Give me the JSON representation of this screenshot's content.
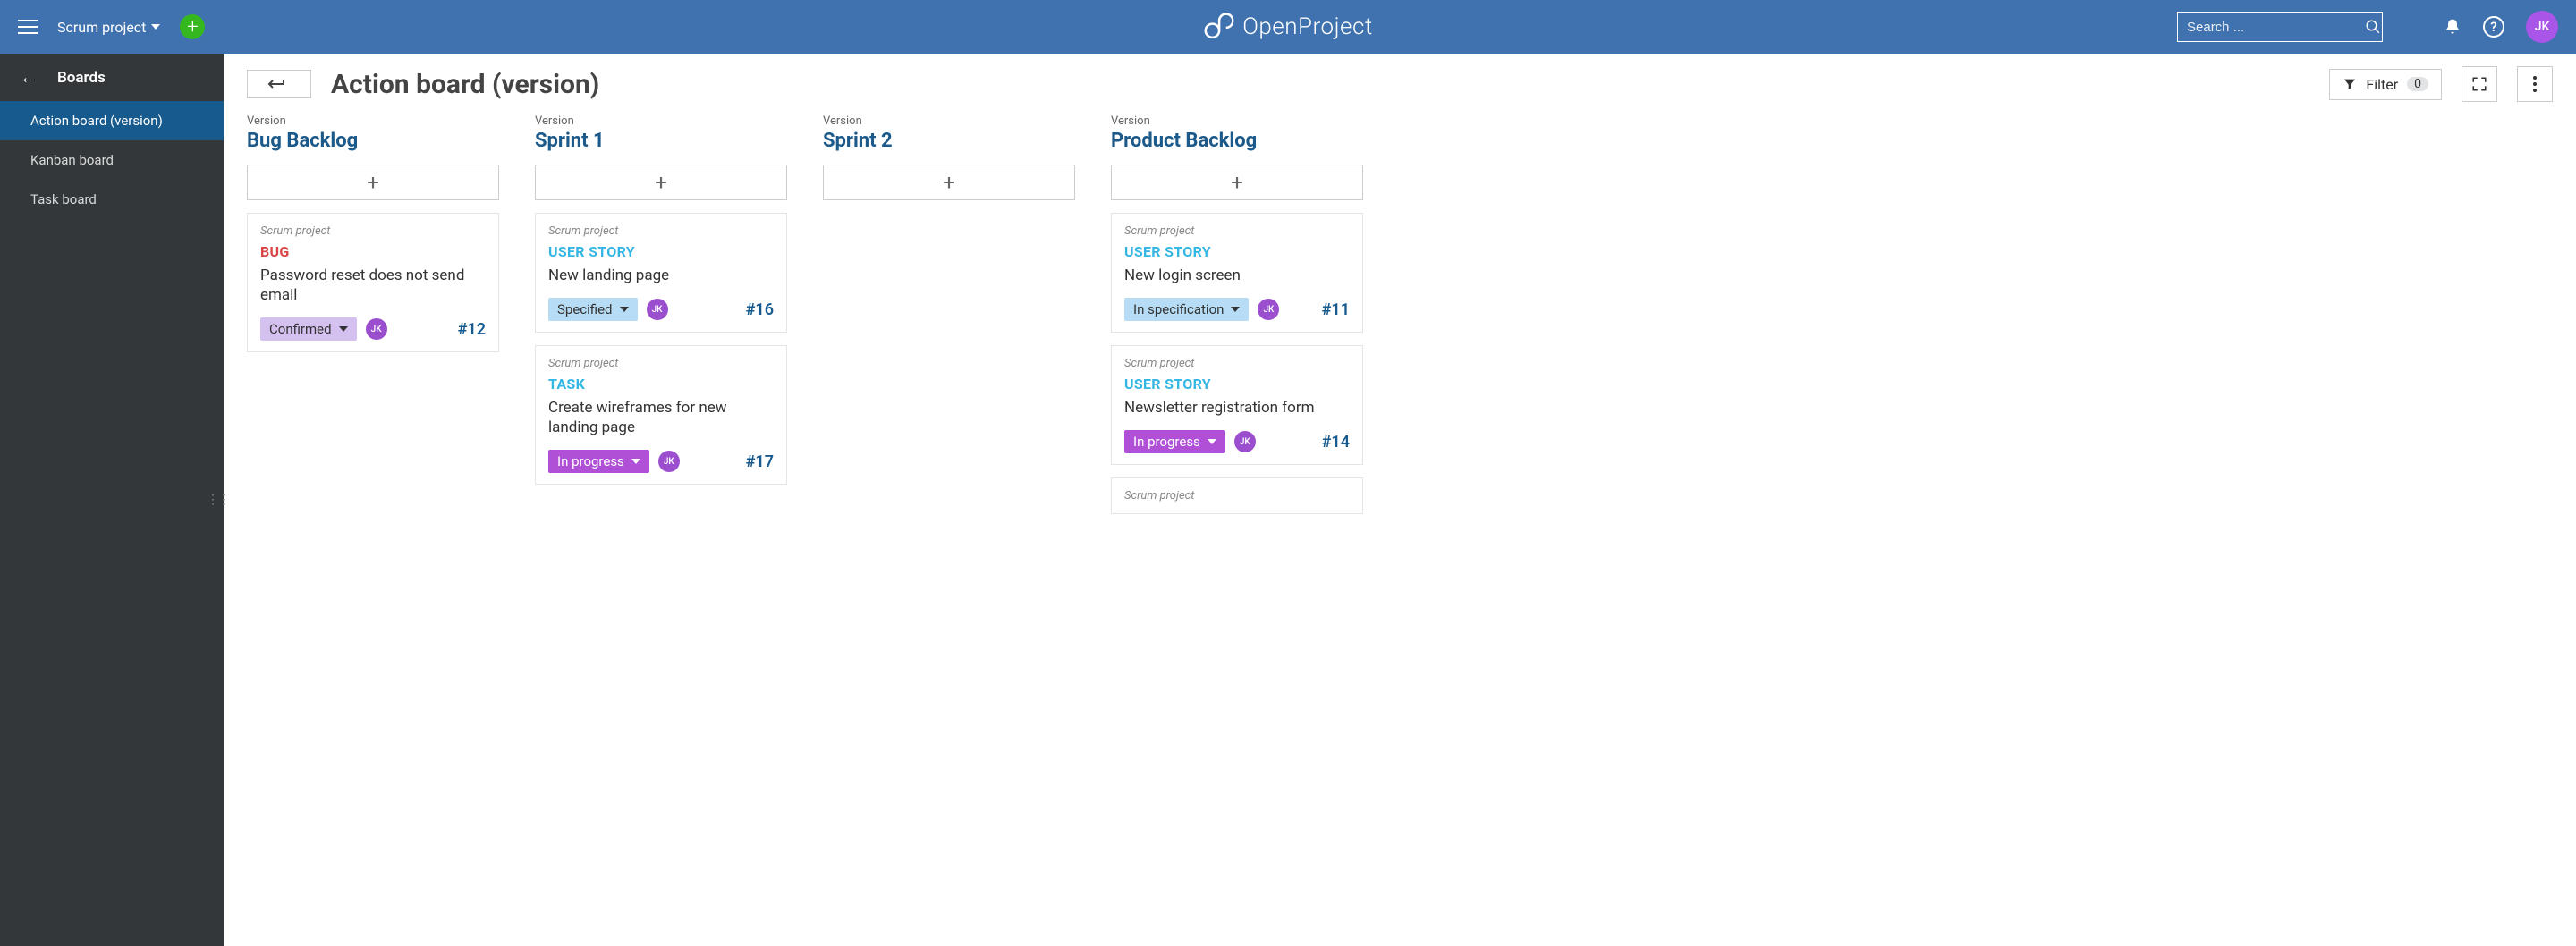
{
  "header": {
    "project_name": "Scrum project",
    "logo_text": "OpenProject",
    "search_placeholder": "Search ...",
    "user_initials": "JK"
  },
  "sidebar": {
    "section_title": "Boards",
    "items": [
      {
        "label": "Action board (version)",
        "active": true
      },
      {
        "label": "Kanban board",
        "active": false
      },
      {
        "label": "Task board",
        "active": false
      }
    ]
  },
  "toolbar": {
    "page_title": "Action board (version)",
    "filter_label": "Filter",
    "filter_count": "0"
  },
  "board": {
    "column_label": "Version",
    "columns": [
      {
        "title": "Bug Backlog",
        "cards": [
          {
            "project": "Scrum project",
            "type": "BUG",
            "type_class": "type-bug",
            "title": "Password reset does not send email",
            "status": "Confirmed",
            "status_class": "status-confirmed",
            "assignee": "JK",
            "id": "#12"
          }
        ]
      },
      {
        "title": "Sprint 1",
        "cards": [
          {
            "project": "Scrum project",
            "type": "USER STORY",
            "type_class": "type-userstory",
            "title": "New landing page",
            "status": "Specified",
            "status_class": "status-specified",
            "assignee": "JK",
            "id": "#16"
          },
          {
            "project": "Scrum project",
            "type": "TASK",
            "type_class": "type-task",
            "title": "Create wireframes for new landing page",
            "status": "In progress",
            "status_class": "status-inprogress",
            "assignee": "JK",
            "id": "#17"
          }
        ]
      },
      {
        "title": "Sprint 2",
        "cards": []
      },
      {
        "title": "Product Backlog",
        "cards": [
          {
            "project": "Scrum project",
            "type": "USER STORY",
            "type_class": "type-userstory",
            "title": "New login screen",
            "status": "In specification",
            "status_class": "status-inspec",
            "assignee": "JK",
            "id": "#11"
          },
          {
            "project": "Scrum project",
            "type": "USER STORY",
            "type_class": "type-userstory",
            "title": "Newsletter registration form",
            "status": "In progress",
            "status_class": "status-inprogress",
            "assignee": "JK",
            "id": "#14"
          },
          {
            "project": "Scrum project",
            "type": "",
            "type_class": "",
            "title": "",
            "status": "",
            "status_class": "",
            "assignee": "",
            "id": ""
          }
        ]
      }
    ]
  }
}
